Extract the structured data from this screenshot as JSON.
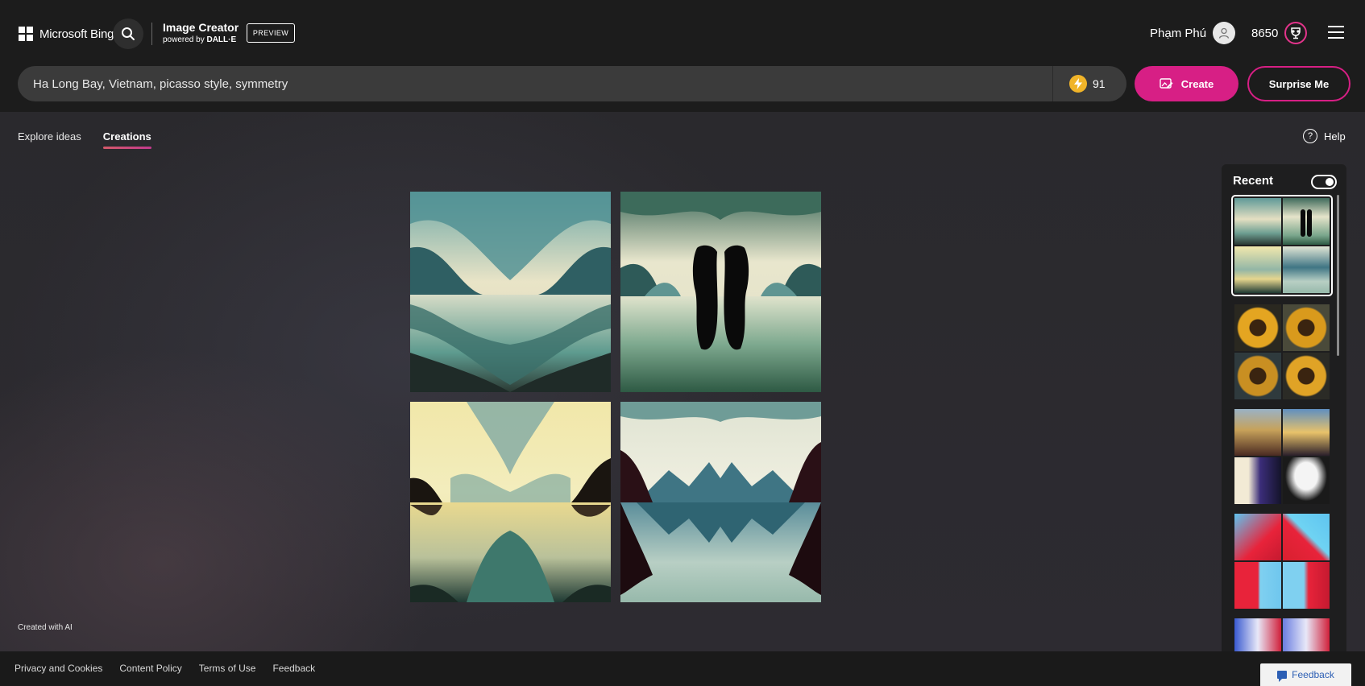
{
  "header": {
    "logo_text": "Microsoft Bing",
    "brand_title": "Image Creator",
    "brand_sub_prefix": "powered by",
    "brand_sub_strong": "DALL·E",
    "preview_badge": "PREVIEW",
    "user_name": "Phạm Phú",
    "points": "8650"
  },
  "prompt": {
    "value": "Ha Long Bay, Vietnam, picasso style, symmetry",
    "boosts": "91",
    "create_label": "Create",
    "surprise_label": "Surprise Me"
  },
  "tabs": [
    {
      "label": "Explore ideas",
      "active": false
    },
    {
      "label": "Creations",
      "active": true
    }
  ],
  "help_label": "Help",
  "created_with_ai": "Created with AI",
  "recent": {
    "title": "Recent",
    "toggle_on": true
  },
  "footer": {
    "links": [
      "Privacy and Cookies",
      "Content Policy",
      "Terms of Use",
      "Feedback"
    ],
    "feedback_button": "Feedback"
  },
  "colors": {
    "accent": "#d71f85",
    "header_bg": "#1c1c1c",
    "boost": "#f0b429"
  },
  "icons": {
    "search": "search-icon",
    "avatar": "person-icon",
    "rewards": "trophy-icon",
    "menu": "hamburger-icon",
    "boost": "lightning-icon",
    "create": "image-edit-icon",
    "help": "question-circle-icon",
    "feedback": "chat-icon"
  }
}
